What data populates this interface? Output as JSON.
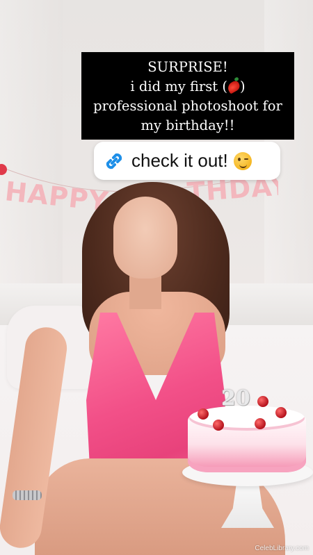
{
  "caption": {
    "line1": "SURPRISE!",
    "line2_before": "i did my first (",
    "line2_after": ")",
    "line3": "professional photoshoot for",
    "line4": "my birthday!!",
    "emoji_icon": "chili-pepper-icon"
  },
  "link_sticker": {
    "label": "check it out!",
    "icon": "link-icon",
    "emoji": "winking-face-icon",
    "icon_color": "#1e8fe8"
  },
  "photo": {
    "banner_text": "HAPPY BIRTHDAY",
    "candle_number": "20"
  },
  "watermark": "CelebLibrary.com",
  "colors": {
    "caption_bg": "#000000",
    "caption_text": "#ffffff",
    "dress": "#f25088",
    "banner_letters": "#f3b7bd"
  }
}
